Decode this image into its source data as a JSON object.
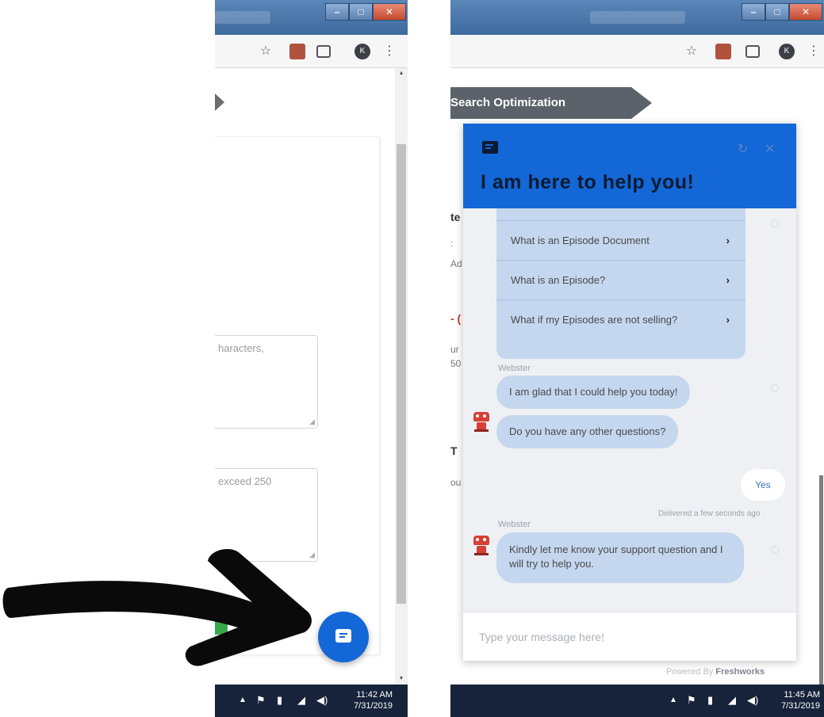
{
  "left": {
    "toolbar_icons": {
      "star": "☆",
      "more": "⋮",
      "avatar_letter": "K"
    },
    "textarea_1_text": "haracters,",
    "textarea_2_text": "exceed 250",
    "taskbar": {
      "time": "11:42 AM",
      "date": "7/31/2019"
    }
  },
  "right": {
    "toolbar_icons": {
      "star": "☆",
      "more": "⋮",
      "avatar_letter": "K"
    },
    "ribbon_label": "Search Optimization",
    "page_fragments": [
      "te",
      ":",
      "Ad",
      "- (",
      "ur",
      "50",
      "T",
      "ou"
    ],
    "widget": {
      "title": "I am here to help you!",
      "faq_items": [
        {
          "label": "What is an Episode Document",
          "chevron": "›"
        },
        {
          "label": "What is an Episode?",
          "chevron": "›"
        },
        {
          "label": "What if my Episodes are not selling?",
          "chevron": "›"
        }
      ],
      "sender_name": "Webster",
      "messages": [
        "I am glad that I could help you today!",
        "Do you have any other questions?"
      ],
      "user_reply": "Yes",
      "delivered_status": "Delivered a few seconds ago",
      "final_message": "Kindly let me know your support question and I will try to help you.",
      "composer_placeholder": "Type your message here!",
      "header_controls": {
        "refresh": "↻",
        "close": "✕"
      }
    },
    "powered_by_prefix": "Powered By",
    "powered_by_brand": "Freshworks",
    "taskbar": {
      "time": "11:45 AM",
      "date": "7/31/2019"
    }
  },
  "colors": {
    "brand_blue": "#1467d6",
    "bubble_blue": "#c4d7ef",
    "taskbar": "#16233a",
    "ribbon": "#5c6269"
  },
  "icons": [
    "star-icon",
    "extension-icon",
    "cast-icon",
    "profile-avatar",
    "more-icon",
    "chat-bubble-icon",
    "refresh-icon",
    "close-icon",
    "chevron-right-icon",
    "bot-avatar-icon",
    "flag-icon",
    "network-icon",
    "volume-icon",
    "arrow-up-icon"
  ]
}
